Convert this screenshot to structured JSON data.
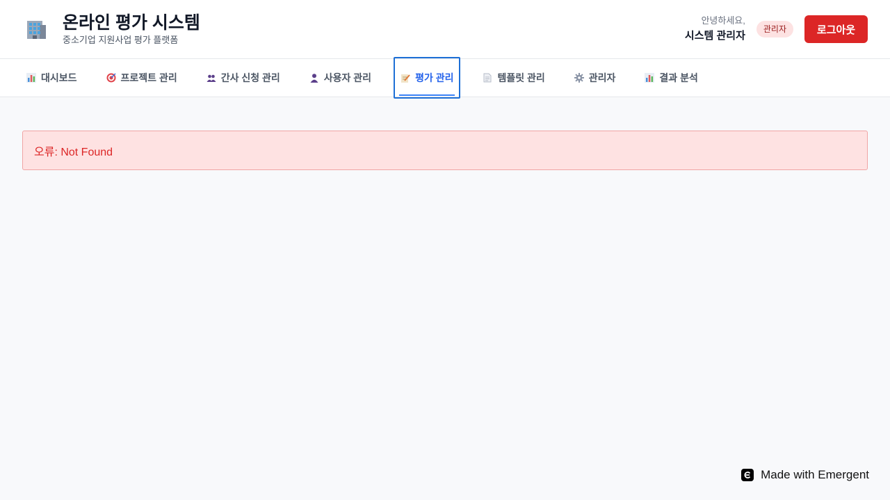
{
  "header": {
    "title": "온라인 평가 시스템",
    "subtitle": "중소기업 지원사업 평가 플랫폼",
    "greeting": "안녕하세요,",
    "user_name": "시스템 관리자",
    "role_badge": "관리자",
    "logout_label": "로그아웃"
  },
  "nav": {
    "items": [
      {
        "label": "대시보드",
        "icon": "bar-chart-icon"
      },
      {
        "label": "프로젝트 관리",
        "icon": "target-icon"
      },
      {
        "label": "간사 신청 관리",
        "icon": "people-icon"
      },
      {
        "label": "사용자 관리",
        "icon": "user-icon"
      },
      {
        "label": "평가 관리",
        "icon": "memo-icon",
        "active": true
      },
      {
        "label": "템플릿 관리",
        "icon": "document-icon"
      },
      {
        "label": "관리자",
        "icon": "gear-icon"
      },
      {
        "label": "결과 분석",
        "icon": "bar-chart-icon"
      }
    ]
  },
  "main": {
    "error_message": "오류: Not Found"
  },
  "footer": {
    "badge_label": "Made with Emergent"
  },
  "colors": {
    "accent": "#2563eb",
    "danger": "#dc2626",
    "error_bg": "#fee2e2",
    "page_bg": "#f8f9fb"
  }
}
